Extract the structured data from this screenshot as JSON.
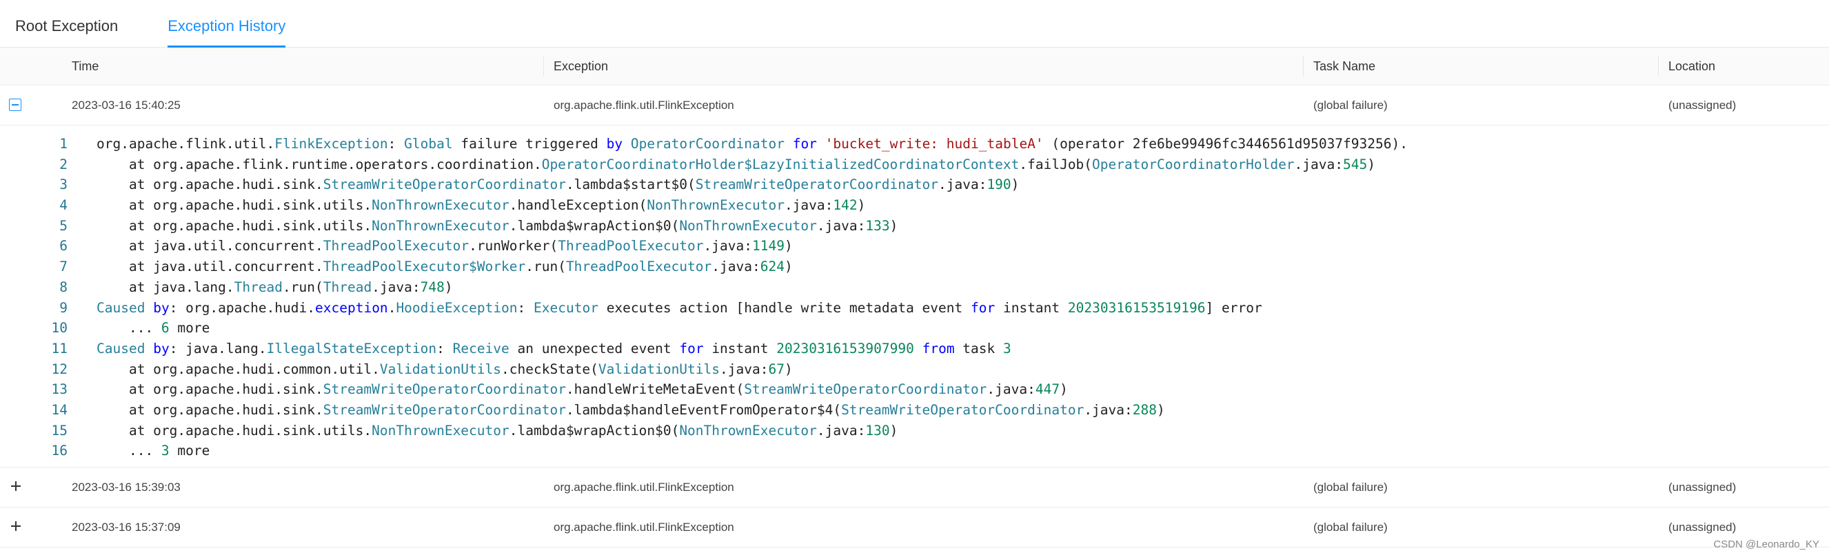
{
  "tabs": [
    {
      "label": "Root Exception",
      "active": false
    },
    {
      "label": "Exception History",
      "active": true
    }
  ],
  "table": {
    "columns": [
      "Time",
      "Exception",
      "Task Name",
      "Location"
    ],
    "rows": [
      {
        "time": "2023-03-16 15:40:25",
        "exception": "org.apache.flink.util.FlinkException",
        "task_name": "(global failure)",
        "location": "(unassigned)",
        "expanded": true
      },
      {
        "time": "2023-03-16 15:39:03",
        "exception": "org.apache.flink.util.FlinkException",
        "task_name": "(global failure)",
        "location": "(unassigned)",
        "expanded": false
      },
      {
        "time": "2023-03-16 15:37:09",
        "exception": "org.apache.flink.util.FlinkException",
        "task_name": "(global failure)",
        "location": "(unassigned)",
        "expanded": false
      }
    ]
  },
  "stacktrace": [
    {
      "n": "1",
      "segs": [
        [
          "",
          "org.apache.flink.util."
        ],
        [
          "ty",
          "FlinkException"
        ],
        [
          "",
          ": "
        ],
        [
          "ty",
          "Global"
        ],
        [
          "",
          " failure triggered "
        ],
        [
          "kw",
          "by"
        ],
        [
          "",
          " "
        ],
        [
          "ty",
          "OperatorCoordinator"
        ],
        [
          "",
          " "
        ],
        [
          "kw",
          "for"
        ],
        [
          "",
          " "
        ],
        [
          "st",
          "'bucket_write: hudi_tableA'"
        ],
        [
          "",
          " (operator 2fe6be99496fc3446561d95037f93256)."
        ]
      ]
    },
    {
      "n": "2",
      "segs": [
        [
          "",
          "    at org.apache.flink.runtime.operators.coordination."
        ],
        [
          "ty",
          "OperatorCoordinatorHolder$LazyInitializedCoordinatorContext"
        ],
        [
          "",
          ".failJob("
        ],
        [
          "ty",
          "OperatorCoordinatorHolder"
        ],
        [
          "",
          ".java:"
        ],
        [
          "nm",
          "545"
        ],
        [
          "",
          ")"
        ]
      ]
    },
    {
      "n": "3",
      "segs": [
        [
          "",
          "    at org.apache.hudi.sink."
        ],
        [
          "ty",
          "StreamWriteOperatorCoordinator"
        ],
        [
          "",
          ".lambda$start$0("
        ],
        [
          "ty",
          "StreamWriteOperatorCoordinator"
        ],
        [
          "",
          ".java:"
        ],
        [
          "nm",
          "190"
        ],
        [
          "",
          ")"
        ]
      ]
    },
    {
      "n": "4",
      "segs": [
        [
          "",
          "    at org.apache.hudi.sink.utils."
        ],
        [
          "ty",
          "NonThrownExecutor"
        ],
        [
          "",
          ".handleException("
        ],
        [
          "ty",
          "NonThrownExecutor"
        ],
        [
          "",
          ".java:"
        ],
        [
          "nm",
          "142"
        ],
        [
          "",
          ")"
        ]
      ]
    },
    {
      "n": "5",
      "segs": [
        [
          "",
          "    at org.apache.hudi.sink.utils."
        ],
        [
          "ty",
          "NonThrownExecutor"
        ],
        [
          "",
          ".lambda$wrapAction$0("
        ],
        [
          "ty",
          "NonThrownExecutor"
        ],
        [
          "",
          ".java:"
        ],
        [
          "nm",
          "133"
        ],
        [
          "",
          ")"
        ]
      ]
    },
    {
      "n": "6",
      "segs": [
        [
          "",
          "    at java.util.concurrent."
        ],
        [
          "ty",
          "ThreadPoolExecutor"
        ],
        [
          "",
          ".runWorker("
        ],
        [
          "ty",
          "ThreadPoolExecutor"
        ],
        [
          "",
          ".java:"
        ],
        [
          "nm",
          "1149"
        ],
        [
          "",
          ")"
        ]
      ]
    },
    {
      "n": "7",
      "segs": [
        [
          "",
          "    at java.util.concurrent."
        ],
        [
          "ty",
          "ThreadPoolExecutor$Worker"
        ],
        [
          "",
          ".run("
        ],
        [
          "ty",
          "ThreadPoolExecutor"
        ],
        [
          "",
          ".java:"
        ],
        [
          "nm",
          "624"
        ],
        [
          "",
          ")"
        ]
      ]
    },
    {
      "n": "8",
      "segs": [
        [
          "",
          "    at java.lang."
        ],
        [
          "ty",
          "Thread"
        ],
        [
          "",
          ".run("
        ],
        [
          "ty",
          "Thread"
        ],
        [
          "",
          ".java:"
        ],
        [
          "nm",
          "748"
        ],
        [
          "",
          ")"
        ]
      ]
    },
    {
      "n": "9",
      "segs": [
        [
          "ty",
          "Caused"
        ],
        [
          "",
          " "
        ],
        [
          "kw",
          "by"
        ],
        [
          "",
          ": org.apache.hudi."
        ],
        [
          "kw",
          "exception"
        ],
        [
          "",
          "."
        ],
        [
          "ty",
          "HoodieException"
        ],
        [
          "",
          ": "
        ],
        [
          "ty",
          "Executor"
        ],
        [
          "",
          " executes action [handle write metadata event "
        ],
        [
          "kw",
          "for"
        ],
        [
          "",
          " instant "
        ],
        [
          "nm",
          "20230316153519196"
        ],
        [
          "",
          "] error"
        ]
      ]
    },
    {
      "n": "10",
      "segs": [
        [
          "",
          "    ... "
        ],
        [
          "nm",
          "6"
        ],
        [
          "",
          " more"
        ]
      ]
    },
    {
      "n": "11",
      "segs": [
        [
          "ty",
          "Caused"
        ],
        [
          "",
          " "
        ],
        [
          "kw",
          "by"
        ],
        [
          "",
          ": java.lang."
        ],
        [
          "ty",
          "IllegalStateException"
        ],
        [
          "",
          ": "
        ],
        [
          "ty",
          "Receive"
        ],
        [
          "",
          " an unexpected event "
        ],
        [
          "kw",
          "for"
        ],
        [
          "",
          " instant "
        ],
        [
          "nm",
          "20230316153907990"
        ],
        [
          "",
          " "
        ],
        [
          "kw",
          "from"
        ],
        [
          "",
          " task "
        ],
        [
          "nm",
          "3"
        ]
      ]
    },
    {
      "n": "12",
      "segs": [
        [
          "",
          "    at org.apache.hudi.common.util."
        ],
        [
          "ty",
          "ValidationUtils"
        ],
        [
          "",
          ".checkState("
        ],
        [
          "ty",
          "ValidationUtils"
        ],
        [
          "",
          ".java:"
        ],
        [
          "nm",
          "67"
        ],
        [
          "",
          ")"
        ]
      ]
    },
    {
      "n": "13",
      "segs": [
        [
          "",
          "    at org.apache.hudi.sink."
        ],
        [
          "ty",
          "StreamWriteOperatorCoordinator"
        ],
        [
          "",
          ".handleWriteMetaEvent("
        ],
        [
          "ty",
          "StreamWriteOperatorCoordinator"
        ],
        [
          "",
          ".java:"
        ],
        [
          "nm",
          "447"
        ],
        [
          "",
          ")"
        ]
      ]
    },
    {
      "n": "14",
      "segs": [
        [
          "",
          "    at org.apache.hudi.sink."
        ],
        [
          "ty",
          "StreamWriteOperatorCoordinator"
        ],
        [
          "",
          ".lambda$handleEventFromOperator$4("
        ],
        [
          "ty",
          "StreamWriteOperatorCoordinator"
        ],
        [
          "",
          ".java:"
        ],
        [
          "nm",
          "288"
        ],
        [
          "",
          ")"
        ]
      ]
    },
    {
      "n": "15",
      "segs": [
        [
          "",
          "    at org.apache.hudi.sink.utils."
        ],
        [
          "ty",
          "NonThrownExecutor"
        ],
        [
          "",
          ".lambda$wrapAction$0("
        ],
        [
          "ty",
          "NonThrownExecutor"
        ],
        [
          "",
          ".java:"
        ],
        [
          "nm",
          "130"
        ],
        [
          "",
          ")"
        ]
      ]
    },
    {
      "n": "16",
      "segs": [
        [
          "",
          "    ... "
        ],
        [
          "nm",
          "3"
        ],
        [
          "",
          " more"
        ]
      ]
    }
  ],
  "watermark": "CSDN @Leonardo_KY"
}
